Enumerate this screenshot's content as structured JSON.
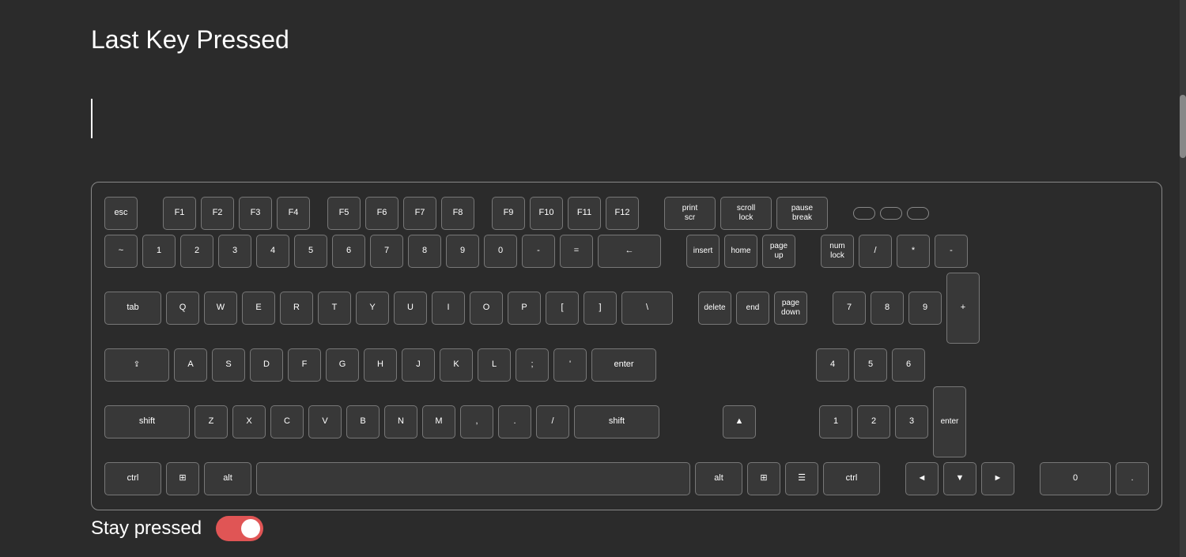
{
  "title": "Last Key Pressed",
  "lastKey": "",
  "stayPressed": {
    "label": "Stay pressed",
    "enabled": true
  },
  "keyboard": {
    "rows": {
      "fn": [
        "esc",
        "F1",
        "F2",
        "F3",
        "F4",
        "F5",
        "F6",
        "F7",
        "F8",
        "F9",
        "F10",
        "F11",
        "F12",
        "print\nscr",
        "scroll\nlock",
        "pause\nbreak"
      ],
      "num": [
        "~",
        "1",
        "2",
        "3",
        "4",
        "5",
        "6",
        "7",
        "8",
        "9",
        "0",
        "-",
        "=",
        "←"
      ],
      "tab": [
        "tab",
        "Q",
        "W",
        "E",
        "R",
        "T",
        "Y",
        "U",
        "I",
        "O",
        "P",
        "[",
        "]",
        "\\"
      ],
      "caps": [
        "caps",
        "A",
        "S",
        "D",
        "F",
        "G",
        "H",
        "J",
        "K",
        "L",
        ";",
        "'",
        "enter"
      ],
      "shift": [
        "shift",
        "Z",
        "X",
        "C",
        "V",
        "B",
        "N",
        "M",
        ",",
        ".",
        "/",
        "shift"
      ],
      "ctrl": [
        "ctrl",
        "⊞",
        "alt",
        "",
        "alt",
        "⊞",
        "☰",
        "ctrl"
      ]
    },
    "navigation": [
      "insert",
      "home",
      "page\nup",
      "delete",
      "end",
      "page\ndown"
    ],
    "arrows": [
      "▲",
      "◄",
      "▼",
      "►"
    ],
    "numpad": {
      "top": [
        "num\nlock",
        "/",
        "*",
        "-"
      ],
      "mid1": [
        "7",
        "8",
        "9",
        "+"
      ],
      "mid2": [
        "4",
        "5",
        "6"
      ],
      "mid3": [
        "1",
        "2",
        "3",
        "enter"
      ],
      "bot": [
        "0",
        "."
      ]
    }
  }
}
